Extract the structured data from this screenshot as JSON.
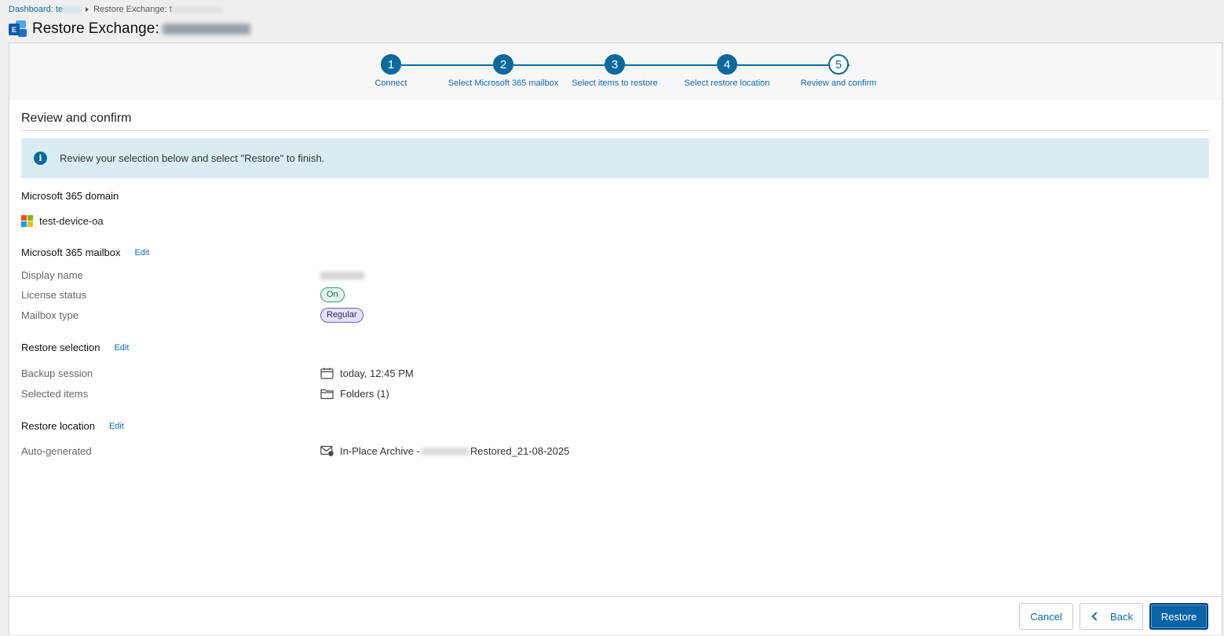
{
  "breadcrumb": {
    "dashboard_label": "Dashboard: te",
    "current_label": "Restore Exchange: t"
  },
  "header": {
    "title": "Restore Exchange:"
  },
  "wizard": {
    "steps": [
      {
        "number": "1",
        "label": "Connect"
      },
      {
        "number": "2",
        "label": "Select Microsoft 365 mailbox"
      },
      {
        "number": "3",
        "label": "Select items to restore"
      },
      {
        "number": "4",
        "label": "Select restore location"
      },
      {
        "number": "5",
        "label": "Review and confirm"
      }
    ],
    "current_step": 5
  },
  "main": {
    "section_title": "Review and confirm",
    "info_text": "Review your selection below and select \"Restore\" to finish.",
    "domain": {
      "heading": "Microsoft 365 domain",
      "value": "test-device-oa"
    },
    "mailbox": {
      "heading": "Microsoft 365 mailbox",
      "edit_label": "Edit",
      "display_name_label": "Display name",
      "license_status_label": "License status",
      "license_status_value": "On",
      "mailbox_type_label": "Mailbox type",
      "mailbox_type_value": "Regular"
    },
    "selection": {
      "heading": "Restore selection",
      "edit_label": "Edit",
      "backup_session_label": "Backup session",
      "backup_session_value": "today, 12:45 PM",
      "selected_items_label": "Selected items",
      "selected_items_value": "Folders (1)"
    },
    "location": {
      "heading": "Restore location",
      "edit_label": "Edit",
      "auto_generated_label": "Auto-generated",
      "location_prefix": "In-Place Archive -",
      "location_suffix": "Restored_21-08-2025"
    }
  },
  "footer": {
    "cancel_label": "Cancel",
    "back_label": "Back",
    "restore_label": "Restore"
  },
  "colors": {
    "accent": "#0b6a9c",
    "link": "#0a6aa6",
    "info_background": "#d9ecf4",
    "primary_button": "#0b63a8"
  }
}
